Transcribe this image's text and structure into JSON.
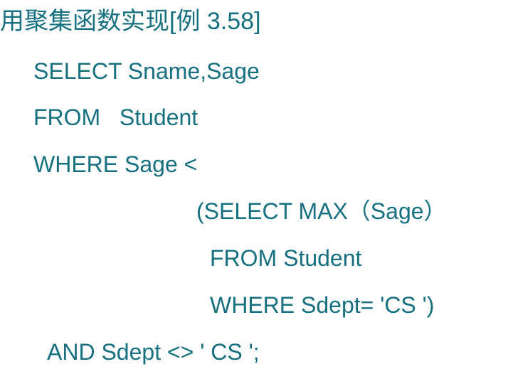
{
  "slide": {
    "title_prefix": "用聚集函数实现",
    "title_suffix": "[例 3.58]",
    "sql_lines": [
      "SELECT Sname,Sage",
      "FROM   Student",
      "WHERE Sage <",
      "(SELECT MAX（Sage）",
      "FROM Student",
      "WHERE Sdept= 'CS ')",
      "AND Sdept <> ' CS ';"
    ]
  },
  "colors": {
    "text": "#16707f",
    "background": "#ffffff"
  }
}
